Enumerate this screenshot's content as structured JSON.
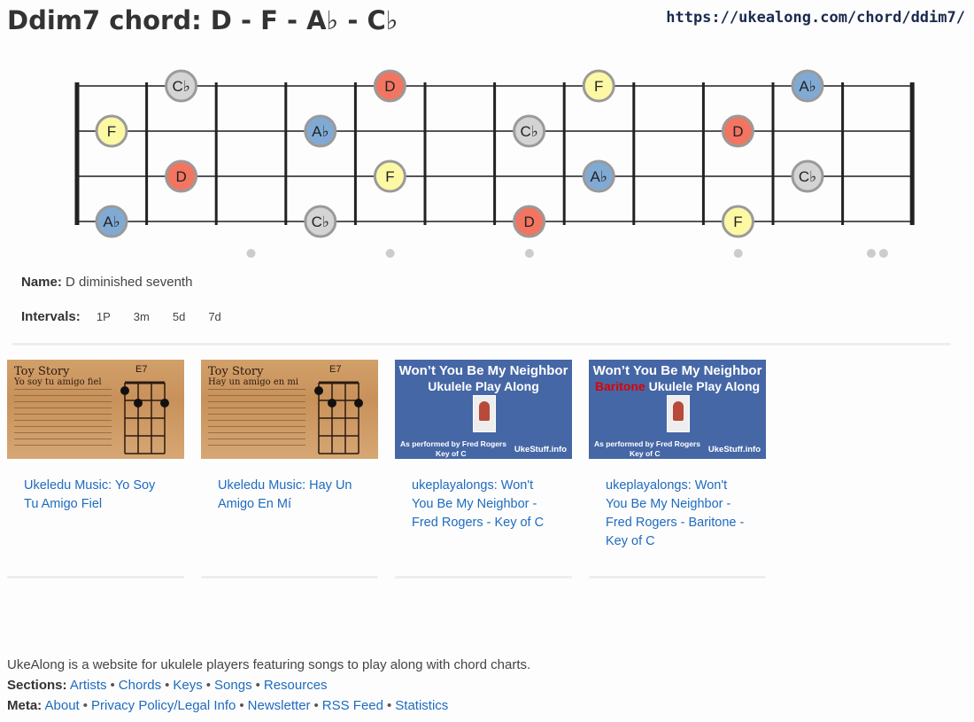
{
  "header": {
    "title": "Ddim7 chord: D - F - A♭ - C♭",
    "url": "https://ukealong.com/chord/ddim7/"
  },
  "fretboard": {
    "note_colors": {
      "D": "#f27561",
      "F": "#fdf8a4",
      "A♭": "#80aad4",
      "C♭": "#d4d4d4"
    },
    "note_text_colors": {
      "D": "#222222",
      "F": "#222222",
      "A♭": "#222222",
      "C♭": "#222222"
    },
    "notes": [
      {
        "string": 1,
        "fret": 1,
        "label": "C♭",
        "key": "C♭"
      },
      {
        "string": 1,
        "fret": 4,
        "label": "D",
        "key": "D"
      },
      {
        "string": 1,
        "fret": 7,
        "label": "F",
        "key": "F"
      },
      {
        "string": 1,
        "fret": 10,
        "label": "A♭",
        "key": "A♭"
      },
      {
        "string": 2,
        "fret": 0,
        "label": "F",
        "key": "F"
      },
      {
        "string": 2,
        "fret": 3,
        "label": "A♭",
        "key": "A♭"
      },
      {
        "string": 2,
        "fret": 6,
        "label": "C♭",
        "key": "C♭"
      },
      {
        "string": 2,
        "fret": 9,
        "label": "D",
        "key": "D"
      },
      {
        "string": 3,
        "fret": 1,
        "label": "D",
        "key": "D"
      },
      {
        "string": 3,
        "fret": 4,
        "label": "F",
        "key": "F"
      },
      {
        "string": 3,
        "fret": 7,
        "label": "A♭",
        "key": "A♭"
      },
      {
        "string": 3,
        "fret": 10,
        "label": "C♭",
        "key": "C♭"
      },
      {
        "string": 4,
        "fret": 0,
        "label": "A♭",
        "key": "A♭"
      },
      {
        "string": 4,
        "fret": 3,
        "label": "C♭",
        "key": "C♭"
      },
      {
        "string": 4,
        "fret": 6,
        "label": "D",
        "key": "D"
      },
      {
        "string": 4,
        "fret": 9,
        "label": "F",
        "key": "F"
      }
    ],
    "inlay_frets": [
      3,
      5,
      7,
      10
    ],
    "double_inlay_frets": [
      12
    ]
  },
  "info": {
    "name_label": "Name:",
    "name_value": "D diminished seventh",
    "intervals_label": "Intervals:",
    "intervals": [
      "1P",
      "3m",
      "5d",
      "7d"
    ]
  },
  "videos": [
    {
      "title": "Ukeledu Music: Yo Soy Tu Amigo Fiel",
      "thumb": {
        "style": "wood",
        "song": "Toy Story",
        "subtitle": "Yo soy tu amigo fiel",
        "chord": "E7"
      }
    },
    {
      "title": "Ukeledu Music: Hay Un Amigo En Mí",
      "thumb": {
        "style": "wood",
        "song": "Toy Story",
        "subtitle": "Hay un amigo en mi",
        "chord": "E7"
      }
    },
    {
      "title": "ukeplayalongs: Won't You Be My Neighbor - Fred Rogers - Key of C",
      "thumb": {
        "style": "blue",
        "line1": "Won’t You Be My Neighbor",
        "line2_red": "",
        "line2": "Ukulele Play Along",
        "performer": "As performed by Fred Rogers",
        "key": "Key of C",
        "site": "UkeStuff.info"
      }
    },
    {
      "title": "ukeplayalongs: Won't You Be My Neighbor - Fred Rogers - Baritone - Key of C",
      "thumb": {
        "style": "blue",
        "line1": "Won’t You Be My Neighbor",
        "line2_red": "Baritone",
        "line2": " Ukulele Play Along",
        "performer": "As performed by Fred Rogers",
        "key": "Key of C",
        "site": "UkeStuff.info"
      }
    }
  ],
  "footer": {
    "description": "UkeAlong is a website for ukulele players featuring songs to play along with chord charts.",
    "sections_label": "Sections:",
    "sections": [
      "Artists",
      "Chords",
      "Keys",
      "Songs",
      "Resources"
    ],
    "meta_label": "Meta:",
    "meta": [
      "About",
      "Privacy Policy/Legal Info",
      "Newsletter",
      "RSS Feed",
      "Statistics"
    ],
    "link_color": "#1e6bbf"
  }
}
